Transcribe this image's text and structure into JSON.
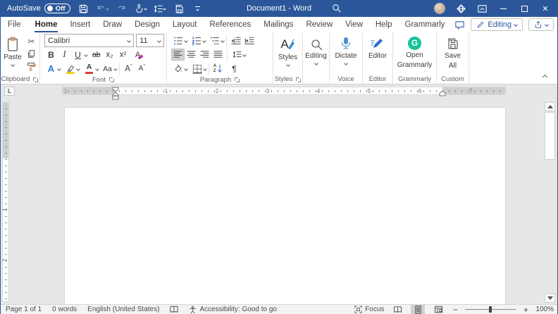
{
  "colors": {
    "titlebar_blue": "#2b579a",
    "accent_blue": "#185abd",
    "grammarly_green": "#15c39a",
    "highlight_yellow": "#ffe000",
    "font_color_red": "#e03c31",
    "clear_format_purple": "#c239b3"
  },
  "title_bar": {
    "autosave_label": "AutoSave",
    "autosave_state": "Off",
    "title": "Document1 - Word",
    "close_glyph": "✕"
  },
  "tab_row": {
    "active_tab": "Home",
    "tabs": [
      {
        "label": "File"
      },
      {
        "label": "Home"
      },
      {
        "label": "Insert"
      },
      {
        "label": "Draw"
      },
      {
        "label": "Design"
      },
      {
        "label": "Layout"
      },
      {
        "label": "References"
      },
      {
        "label": "Mailings"
      },
      {
        "label": "Review"
      },
      {
        "label": "View"
      },
      {
        "label": "Help"
      },
      {
        "label": "Grammarly"
      }
    ],
    "editing_mode_label": "Editing"
  },
  "ribbon": {
    "clipboard": {
      "group_label": "Clipboard",
      "paste_label": "Paste",
      "cut_glyph": "✂"
    },
    "font": {
      "group_label": "Font",
      "font_name": "Calibri",
      "font_size": "11",
      "bold": "B",
      "italic": "I",
      "underline": "U",
      "strikethrough": "ab",
      "subscript": "x₂",
      "superscript": "x²",
      "clear_formatting": "A",
      "text_effects": "A",
      "change_case": "Aa",
      "font_color": "A",
      "highlight_color": "",
      "grow_font": "A",
      "grow_mark": "ˆ",
      "shrink_font": "A",
      "shrink_mark": "ˇ"
    },
    "paragraph": {
      "group_label": "Paragraph",
      "pilcrow": "¶",
      "sort_a": "A",
      "sort_z": "Z"
    },
    "styles": {
      "group_label": "Styles",
      "button_label": "Styles",
      "icon_letter": "A"
    },
    "editing": {
      "button_label": "Editing"
    },
    "voice": {
      "group_label": "Voice",
      "button_label": "Dictate"
    },
    "editor": {
      "group_label": "Editor",
      "button_label": "Editor"
    },
    "grammarly": {
      "group_label": "Grammarly",
      "button_line1": "Open",
      "button_line2": "Grammarly",
      "icon_letter": "G"
    },
    "custom": {
      "group_label": "Custom",
      "button_line1": "Save",
      "button_line2": "All"
    }
  },
  "ruler": {
    "tab_selector": "L",
    "h_left": "1",
    "h_marks": [
      "1",
      "2",
      "3",
      "4",
      "5",
      "6",
      "7"
    ],
    "v_marks": [
      "1",
      "2"
    ]
  },
  "status_bar": {
    "page": "Page 1 of 1",
    "words": "0 words",
    "language": "English (United States)",
    "accessibility": "Accessibility: Good to go",
    "focus": "Focus",
    "zoom_minus": "−",
    "zoom_plus": "+",
    "zoom_level": "100%"
  }
}
